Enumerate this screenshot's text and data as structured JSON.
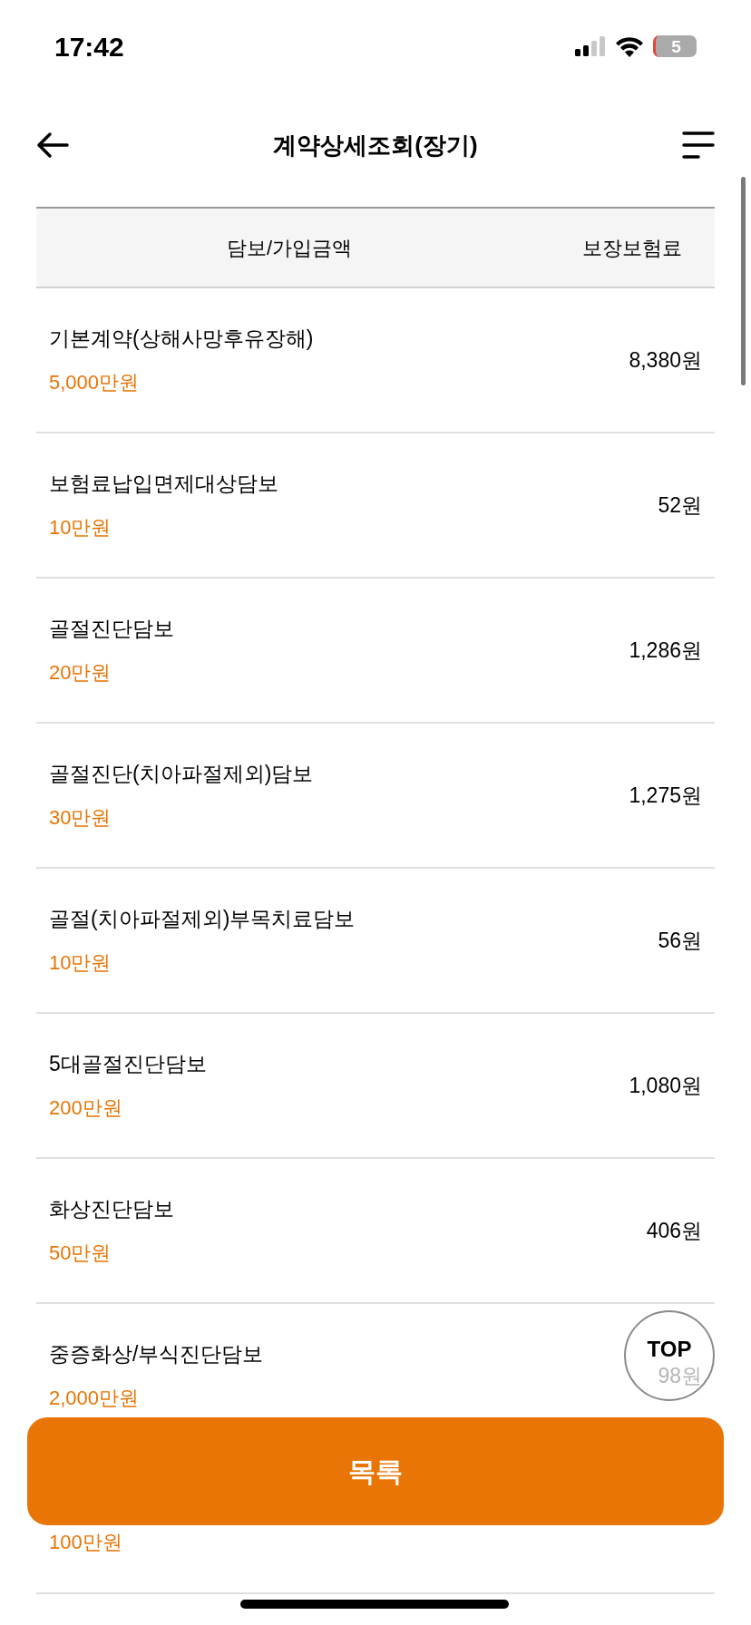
{
  "status_bar": {
    "time": "17:42",
    "battery": "5"
  },
  "header": {
    "title": "계약상세조회(장기)"
  },
  "table": {
    "columns": [
      "담보/가입금액",
      "보장보험료"
    ],
    "rows": [
      {
        "name": "기본계약(상해사망후유장해)",
        "amount": "5,000만원",
        "premium": "8,380원"
      },
      {
        "name": "보험료납입면제대상담보",
        "amount": "10만원",
        "premium": "52원"
      },
      {
        "name": "골절진단담보",
        "amount": "20만원",
        "premium": "1,286원"
      },
      {
        "name": "골절진단(치아파절제외)담보",
        "amount": "30만원",
        "premium": "1,275원"
      },
      {
        "name": "골절(치아파절제외)부목치료담보",
        "amount": "10만원",
        "premium": "56원"
      },
      {
        "name": "5대골절진단담보",
        "amount": "200만원",
        "premium": "1,080원"
      },
      {
        "name": "화상진단담보",
        "amount": "50만원",
        "premium": "406원"
      },
      {
        "name": "중증화상/부식진단담보",
        "amount": "2,000만원",
        "premium": "98원"
      },
      {
        "amount": "100만원"
      }
    ]
  },
  "top_button": {
    "label": "TOP"
  },
  "list_button": {
    "label": "목록"
  }
}
